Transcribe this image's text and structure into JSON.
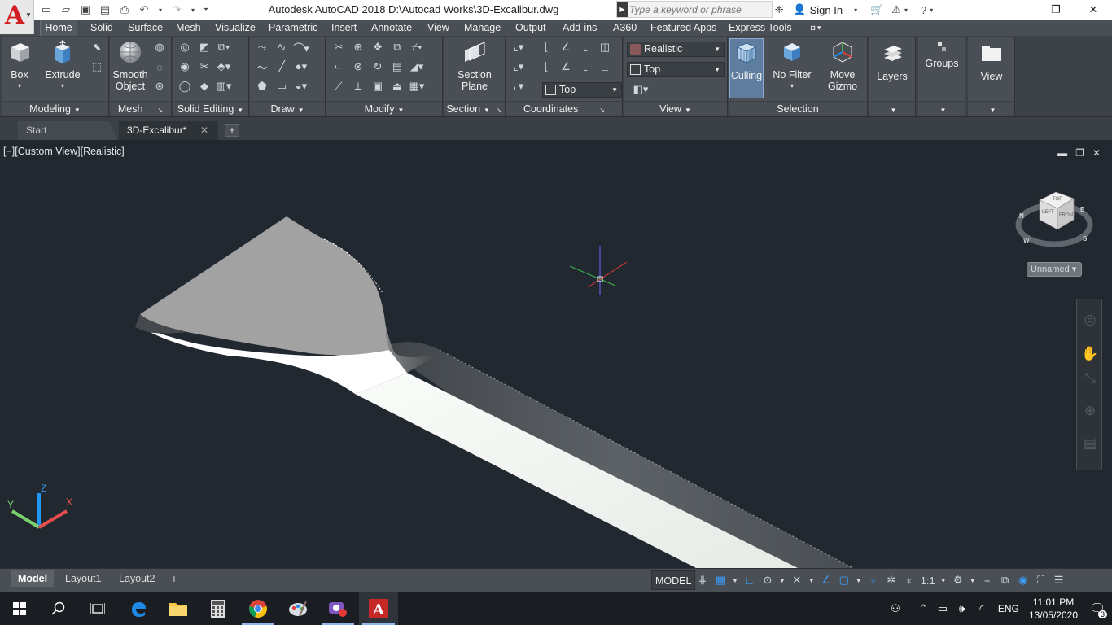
{
  "titlebar": {
    "title": "Autodesk AutoCAD 2018    D:\\Autocad Works\\3D-Excalibur.dwg",
    "search_placeholder": "Type a keyword or phrase",
    "signin_label": "Sign In",
    "app_letter": "A"
  },
  "ribbon_tabs": [
    "Home",
    "Solid",
    "Surface",
    "Mesh",
    "Visualize",
    "Parametric",
    "Insert",
    "Annotate",
    "View",
    "Manage",
    "Output",
    "Add-ins",
    "A360",
    "Featured Apps",
    "Express Tools"
  ],
  "ribbon": {
    "modeling": {
      "title": "Modeling",
      "box_label": "Box",
      "extrude_label": "Extrude"
    },
    "mesh": {
      "title": "Mesh",
      "smooth_label_1": "Smooth",
      "smooth_label_2": "Object"
    },
    "solid_editing": {
      "title": "Solid Editing"
    },
    "draw": {
      "title": "Draw"
    },
    "modify": {
      "title": "Modify"
    },
    "section": {
      "title": "Section",
      "plane_label_1": "Section",
      "plane_label_2": "Plane"
    },
    "coordinates": {
      "title": "Coordinates"
    },
    "view": {
      "title": "View",
      "visual_style": "Realistic",
      "view_name": "Top",
      "coord_view": "Top"
    },
    "selection": {
      "title": "Selection",
      "culling_label": "Culling",
      "nofilter_label": "No Filter",
      "gizmo_label_1": "Move",
      "gizmo_label_2": "Gizmo"
    },
    "layers_label": "Layers",
    "groups_label": "Groups",
    "view_btn_label": "View"
  },
  "file_tabs": {
    "start": "Start",
    "current": "3D-Excalibur*"
  },
  "viewport": {
    "label": "[−][Custom View][Realistic]",
    "named_view": "Unnamed"
  },
  "viewcube": {
    "top": "TOP",
    "left": "LEFT",
    "front": "FRONT",
    "n": "N",
    "e": "E",
    "s": "S",
    "w": "W"
  },
  "ucs": {
    "x": "X",
    "y": "Y",
    "z": "Z"
  },
  "layout_tabs": [
    "Model",
    "Layout1",
    "Layout2"
  ],
  "status": {
    "model": "MODEL",
    "scale": "1:1"
  },
  "taskbar": {
    "lang": "ENG",
    "time": "11:01 PM",
    "date": "13/05/2020",
    "notifications": "3"
  },
  "colors": {
    "accent": "#4a90d9",
    "autocad_red": "#d21e20",
    "viewport_bg": "#212830",
    "ribbon_bg": "#4a4f55"
  }
}
